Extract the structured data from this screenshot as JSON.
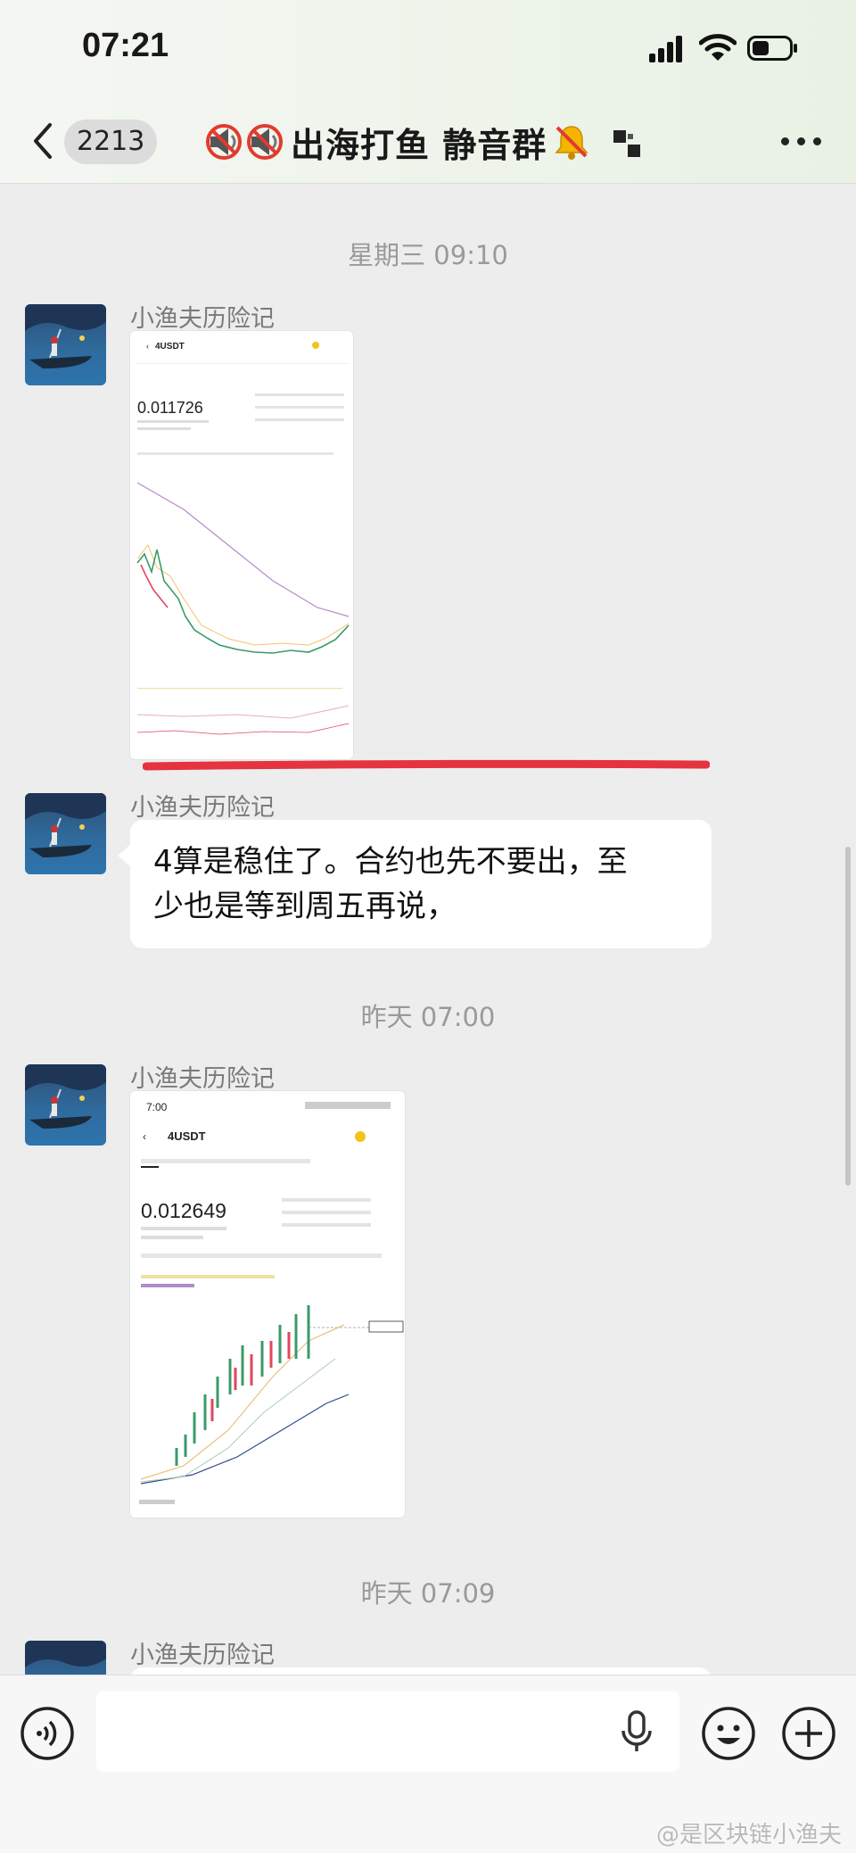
{
  "status_bar": {
    "time": "07:21"
  },
  "nav": {
    "unread_count": "2213",
    "title": "出海打鱼 静音群"
  },
  "messages": [
    {
      "type": "timestamp",
      "text": "星期三 09:10"
    },
    {
      "type": "image",
      "sender": "小渔夫历险记",
      "screenshot": {
        "symbol": "4USDT",
        "price": "0.011726"
      }
    },
    {
      "type": "text",
      "sender": "小渔夫历险记",
      "lines": [
        "4算是稳住了。合约也先不要出，至",
        "少也是等到周五再说，"
      ]
    },
    {
      "type": "timestamp",
      "text": "昨天 07:00"
    },
    {
      "type": "image",
      "sender": "小渔夫历险记",
      "screenshot": {
        "time": "7:00",
        "symbol": "4USDT",
        "price": "0.012649"
      }
    },
    {
      "type": "timestamp",
      "text": "昨天 07:09"
    },
    {
      "type": "text",
      "sender": "小渔夫历险记"
    }
  ],
  "watermark": "@是区块链小渔夫"
}
